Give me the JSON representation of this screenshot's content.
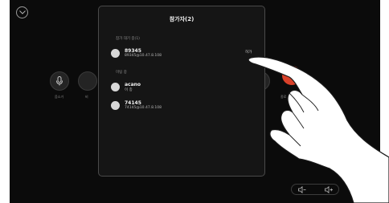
{
  "panel": {
    "title": "참가자(2)",
    "waiting_section": "참가 대기 중(1)",
    "meeting_section": "미팅 중",
    "waiting": [
      {
        "name": "89345",
        "address": "89345@10.47.8.108",
        "admit_label": "허가"
      }
    ],
    "in_meeting": [
      {
        "name": "acano",
        "address": "이 종"
      },
      {
        "name": "74145",
        "address": "74145@10.47.8.108"
      }
    ]
  },
  "background": {
    "mic_label": "음소거",
    "second_label": "비",
    "right_label": "종료"
  },
  "colors": {
    "end_call": "#d9412a",
    "avatar": "#d8d8d8",
    "panel": "#151515"
  },
  "icons": [
    "chevron-down-icon",
    "microphone-icon",
    "volume-down-icon",
    "volume-up-icon"
  ]
}
